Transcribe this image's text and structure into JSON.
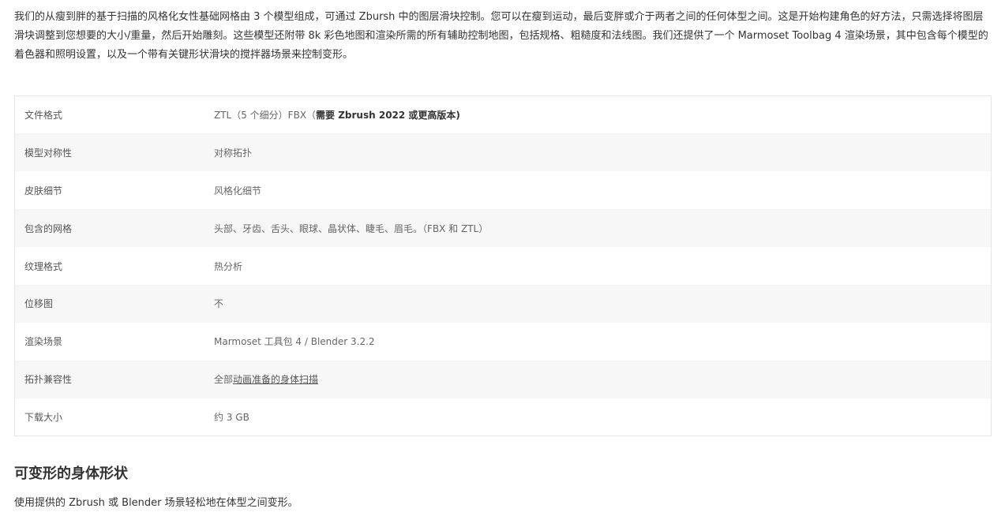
{
  "intro": {
    "text": "我们的从瘦到胖的基于扫描的风格化女性基础网格由 3 个模型组成，可通过 Zbursh 中的图层滑块控制。您可以在瘦到运动，最后变胖或介于两者之间的任何体型之间。这是开始构建角色的好方法，只需选择将图层滑块调整到您想要的大小/重量，然后开始雕刻。这些模型还附带 8k 彩色地图和渲染所需的所有辅助控制地图，包括规格、粗糙度和法线图。我们还提供了一个 Marmoset Toolbag 4 渲染场景，其中包含每个模型的着色器和照明设置，以及一个带有关键形状滑块的搅拌器场景来控制变形。"
  },
  "specs": {
    "file_format": {
      "label": "文件格式",
      "value_prefix": "ZTL（5 个细分）FBX（",
      "value_strong": "需要 Zbrush 2022 或更高版本)"
    },
    "symmetry": {
      "label": "模型对称性",
      "value": "对称拓扑"
    },
    "skin_detail": {
      "label": "皮肤细节",
      "value": "风格化细节"
    },
    "meshes": {
      "label": "包含的网格",
      "value": "头部、牙齿、舌头、眼球、晶状体、睫毛、眉毛。（FBX 和 ZTL）"
    },
    "texture_format": {
      "label": "纹理格式",
      "value": "热分析"
    },
    "displacement": {
      "label": "位移图",
      "value": "不"
    },
    "render_scene": {
      "label": "渲染场景",
      "value": "Marmoset 工具包 4  / Blender 3.2.2"
    },
    "topology": {
      "label": "拓扑兼容性",
      "value_prefix": "全部",
      "value_link": "动画准备的身体扫描"
    },
    "download_size": {
      "label": "下载大小",
      "value": "约 3 GB"
    }
  },
  "section": {
    "title": "可变形的身体形状",
    "text": "使用提供的 Zbrush 或 Blender 场景轻松地在体型之间变形。"
  }
}
